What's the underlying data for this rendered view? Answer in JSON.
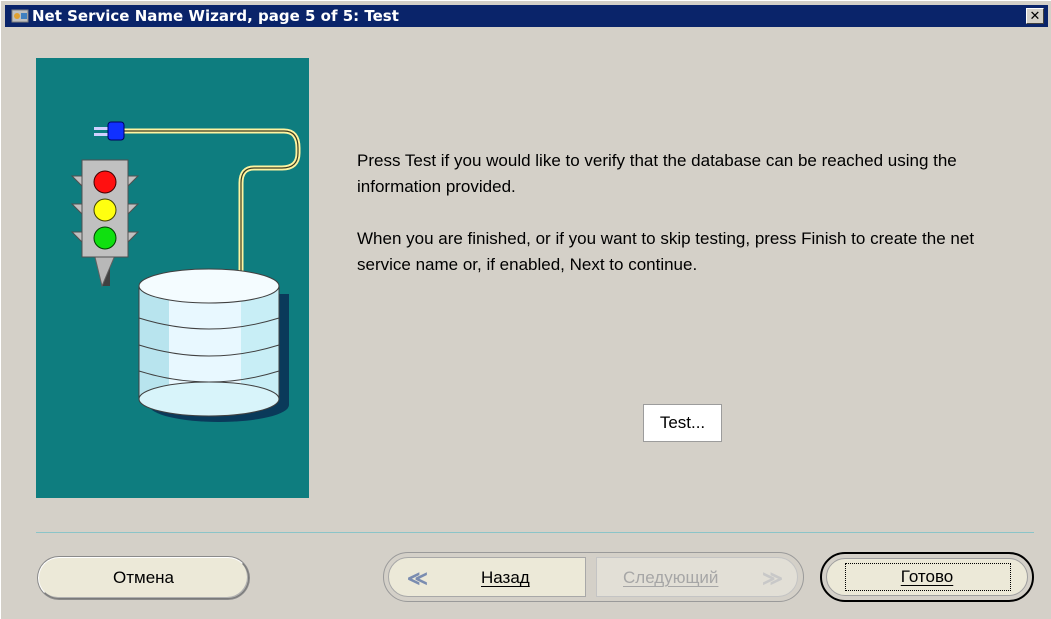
{
  "window": {
    "title": "Net Service Name Wizard, page 5 of 5: Test",
    "title_icon": "wizard-icon",
    "close_glyph": "✕"
  },
  "illustration": {
    "background_color": "#0e7d7f",
    "icons": [
      "traffic-light-icon",
      "database-icon",
      "plug-icon"
    ]
  },
  "instructions": {
    "paragraph1": "Press Test if you would like to verify that the database can be reached using the information provided.",
    "paragraph2": "When you are finished, or if you want to skip testing, press Finish to create the net service name or, if enabled, Next to continue."
  },
  "test_button": {
    "label": "Test..."
  },
  "footer": {
    "cancel_label": "Отмена",
    "back_label": "Назад",
    "back_chevron": "≪",
    "next_label": "Следующий",
    "next_chevron": "≫",
    "next_enabled": false,
    "finish_label": "Готово"
  }
}
